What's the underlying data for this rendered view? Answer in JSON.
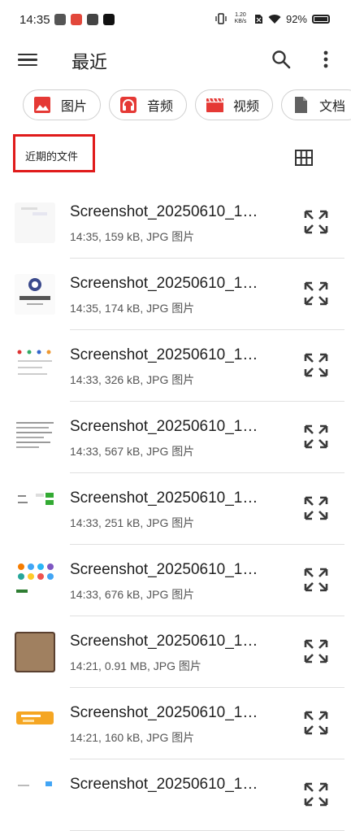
{
  "status_bar": {
    "time": "14:35",
    "net_speed_value": "1.20",
    "net_speed_unit": "KB/s",
    "battery": "92%"
  },
  "app_bar": {
    "title": "最近",
    "menu_icon": "hamburger-menu-icon",
    "search_icon": "search-icon",
    "more_icon": "more-vert-icon"
  },
  "chips": [
    {
      "label": "图片",
      "icon": "image-icon",
      "color": "#e53935"
    },
    {
      "label": "音频",
      "icon": "headphones-icon",
      "color": "#e53935"
    },
    {
      "label": "视频",
      "icon": "movie-icon",
      "color": "#e53935"
    },
    {
      "label": "文档",
      "icon": "document-icon",
      "color": "#616161"
    }
  ],
  "section": {
    "label": "近期的文件",
    "highlight_color": "#e01b1b",
    "view_toggle_icon": "grid-view-icon"
  },
  "files": [
    {
      "name": "Screenshot_20250610_1…",
      "meta": "14:35, 159 kB, JPG 图片"
    },
    {
      "name": "Screenshot_20250610_1…",
      "meta": "14:35, 174 kB, JPG 图片"
    },
    {
      "name": "Screenshot_20250610_1…",
      "meta": "14:33, 326 kB, JPG 图片"
    },
    {
      "name": "Screenshot_20250610_1…",
      "meta": "14:33, 567 kB, JPG 图片"
    },
    {
      "name": "Screenshot_20250610_1…",
      "meta": "14:33, 251 kB, JPG 图片"
    },
    {
      "name": "Screenshot_20250610_1…",
      "meta": "14:33, 676 kB, JPG 图片"
    },
    {
      "name": "Screenshot_20250610_1…",
      "meta": "14:21, 0.91 MB, JPG 图片"
    },
    {
      "name": "Screenshot_20250610_1…",
      "meta": "14:21, 160 kB, JPG 图片"
    },
    {
      "name": "Screenshot_20250610_1…",
      "meta": ""
    }
  ]
}
